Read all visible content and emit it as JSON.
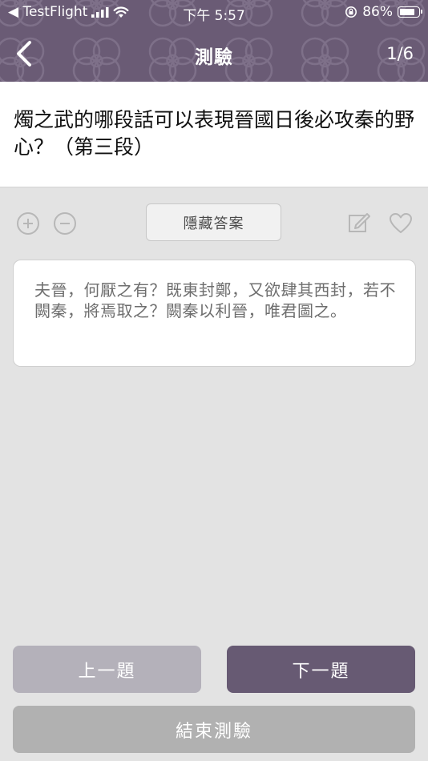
{
  "status_bar": {
    "back_app_label": "◀ TestFlight",
    "time": "下午 5:57",
    "battery_percent": "86%",
    "battery_level": 0.86
  },
  "nav": {
    "title": "測驗",
    "counter": "1/6"
  },
  "question": {
    "text": "燭之武的哪段話可以表現晉國日後必攻秦的野心？（第三段）"
  },
  "toolbar": {
    "hide_answer_label": "隱藏答案"
  },
  "answer": {
    "text": "夫晉，何厭之有？既東封鄭，又欲肆其西封，若不闕秦，將焉取之？闕秦以利晉，唯君圖之。"
  },
  "buttons": {
    "prev_label": "上一題",
    "next_label": "下一題",
    "end_label": "結束測驗"
  },
  "colors": {
    "header": "#6a5b75",
    "primary_button": "#675a73",
    "secondary_button": "#b4b1ba",
    "end_button": "#b1b1b1",
    "page_background": "#e3e3e3"
  },
  "icons": {
    "back": "chevron-left-icon",
    "signal": "cellular-signal-icon",
    "wifi": "wifi-icon",
    "orientation_lock": "orientation-lock-icon",
    "battery": "battery-icon",
    "zoom_in": "zoom-in-icon",
    "zoom_out": "zoom-out-icon",
    "edit": "edit-note-icon",
    "favorite": "heart-icon"
  }
}
